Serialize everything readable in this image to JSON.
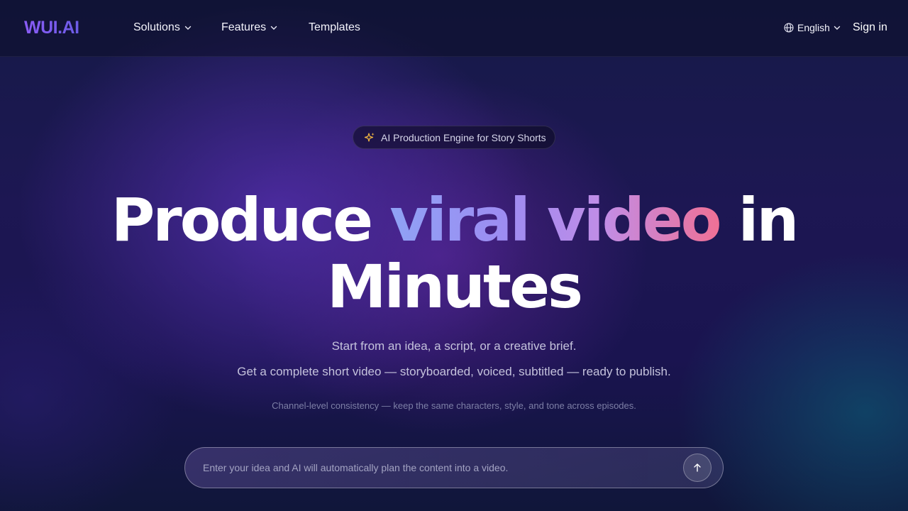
{
  "header": {
    "logo": "WUI.AI",
    "nav": [
      {
        "label": "Solutions",
        "has_dropdown": true
      },
      {
        "label": "Features",
        "has_dropdown": true
      },
      {
        "label": "Templates",
        "has_dropdown": false
      }
    ],
    "language": "English",
    "signin_label": "Sign in"
  },
  "badge": {
    "icon": "sparkles-icon",
    "text": "AI Production Engine for Story Shorts"
  },
  "hero": {
    "title_part1": "Produce ",
    "title_highlight": "viral video",
    "title_part2": " in",
    "title_line2": "Minutes",
    "subtitle1": "Start from an idea, a script, or a creative brief.",
    "subtitle2": "Get a complete short video — storyboarded, voiced, subtitled — ready to publish.",
    "note": "Channel-level consistency — keep the same characters, style, and tone across episodes."
  },
  "prompt": {
    "placeholder": "Enter your idea and AI will automatically plan the content into a video.",
    "value": "",
    "submit_icon": "arrow-up-icon"
  },
  "colors": {
    "logo": "#7b5cf0",
    "highlight_start": "#8fa2f5",
    "highlight_end": "#f07095",
    "sparkle": "#f5b942"
  }
}
